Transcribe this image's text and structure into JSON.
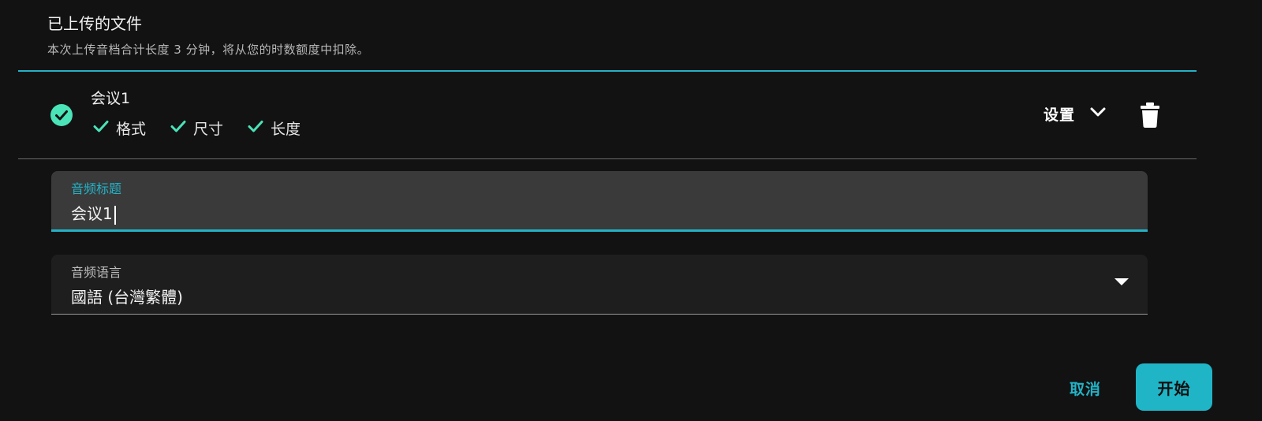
{
  "header": {
    "title": "已上传的文件",
    "subtitle": "本次上传音档合计长度 3 分钟，将从您的时数额度中扣除。"
  },
  "file": {
    "name": "会议1",
    "status_icon": "check-circle-icon",
    "checks": [
      {
        "label": "格式",
        "icon": "check-icon"
      },
      {
        "label": "尺寸",
        "icon": "check-icon"
      },
      {
        "label": "长度",
        "icon": "check-icon"
      }
    ],
    "settings_label": "设置",
    "settings_icon": "chevron-down-icon",
    "delete_icon": "trash-icon"
  },
  "form": {
    "title_label": "音频标题",
    "title_value": "会议1",
    "language_label": "音频语言",
    "language_value": "國語 (台灣繁體)",
    "language_icon": "dropdown-arrow-icon"
  },
  "actions": {
    "cancel_label": "取消",
    "start_label": "开始"
  },
  "colors": {
    "accent": "#23b2c6",
    "check": "#4be3b8",
    "background": "#121212"
  }
}
